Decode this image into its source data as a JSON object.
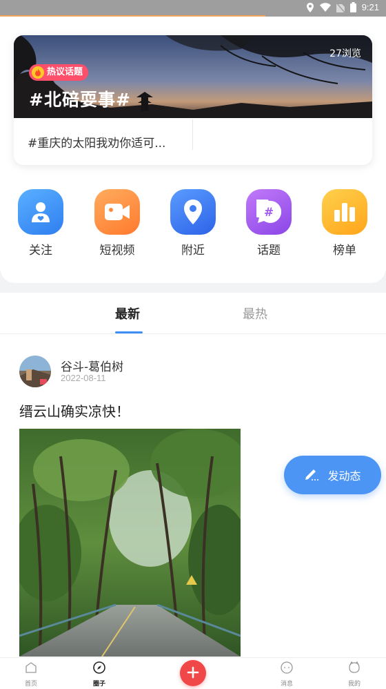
{
  "status_bar": {
    "time": "9:21",
    "battery": "battery-icon",
    "wifi": "wifi-icon",
    "location": "location-icon"
  },
  "topic_card": {
    "badge": "热议话题",
    "title": "#北碚耍事#",
    "views": "27浏览",
    "subtitle": "#重庆的太阳我劝你适可..."
  },
  "shortcuts": [
    {
      "label": "关注",
      "icon": "follow-icon",
      "color": "#3e8ff5"
    },
    {
      "label": "短视频",
      "icon": "video-icon",
      "color": "#ff8a3d"
    },
    {
      "label": "附近",
      "icon": "location-pin-icon",
      "color": "#3e7df5"
    },
    {
      "label": "话题",
      "icon": "hashtag-icon",
      "color": "#a35cf0"
    },
    {
      "label": "榜单",
      "icon": "ranking-icon",
      "color": "#ffb21f"
    }
  ],
  "tabs": {
    "latest": "最新",
    "hot": "最热"
  },
  "post": {
    "author": "谷斗-葛伯树",
    "date": "2022-08-11",
    "text": "缙云山确实凉快！"
  },
  "fab": {
    "label": "发动态"
  },
  "bottom_nav": {
    "home": "首页",
    "circle": "圈子",
    "messages": "消息",
    "mine": "我的"
  },
  "colors": {
    "accent": "#3d8ef5",
    "add_button": "#f04848",
    "badge": "#ff4f6b"
  }
}
